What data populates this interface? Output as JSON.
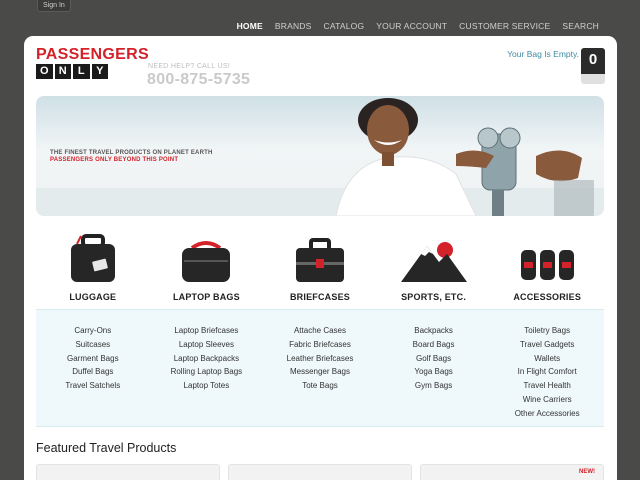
{
  "signin_label": "Sign In",
  "nav": [
    "HOME",
    "BRANDS",
    "CATALOG",
    "YOUR ACCOUNT",
    "CUSTOMER SERVICE",
    "SEARCH"
  ],
  "logo": {
    "line1": "PASSENGERS",
    "line2": [
      "O",
      "N",
      "L",
      "Y"
    ]
  },
  "help_text": "NEED HELP? CALL US!",
  "phone": "800-875-5735",
  "bag": {
    "text": "Your Bag Is Empty.",
    "count": "0"
  },
  "hero": {
    "line1": "THE FINEST TRAVEL PRODUCTS ON PLANET EARTH",
    "line2": "PASSENGERS ONLY BEYOND THIS POINT"
  },
  "categories": [
    {
      "title": "LUGGAGE",
      "icon": "luggage-icon",
      "items": [
        "Carry-Ons",
        "Suitcases",
        "Garment Bags",
        "Duffel Bags",
        "Travel Satchels"
      ]
    },
    {
      "title": "LAPTOP BAGS",
      "icon": "laptop-bag-icon",
      "items": [
        "Laptop Briefcases",
        "Laptop Sleeves",
        "Laptop Backpacks",
        "Rolling Laptop Bags",
        "Laptop Totes"
      ]
    },
    {
      "title": "BRIEFCASES",
      "icon": "briefcase-icon",
      "items": [
        "Attache Cases",
        "Fabric Briefcases",
        "Leather Briefcases",
        "Messenger Bags",
        "Tote Bags"
      ]
    },
    {
      "title": "SPORTS, ETC.",
      "icon": "mountain-icon",
      "items": [
        "Backpacks",
        "Board Bags",
        "Golf Bags",
        "Yoga Bags",
        "Gym Bags"
      ]
    },
    {
      "title": "ACCESSORIES",
      "icon": "accessories-icon",
      "items": [
        "Toiletry Bags",
        "Travel Gadgets",
        "Wallets",
        "In Flight Comfort",
        "Travel Health",
        "Wine Carriers",
        "Other Accessories"
      ]
    }
  ],
  "featured_title": "Featured Travel Products",
  "new_badge": "NEW!",
  "colors": {
    "brand_red": "#d3222a",
    "accent_teal": "#3e8aa1",
    "list_bg": "#eff8fb",
    "page_bg": "#4a4a48"
  }
}
